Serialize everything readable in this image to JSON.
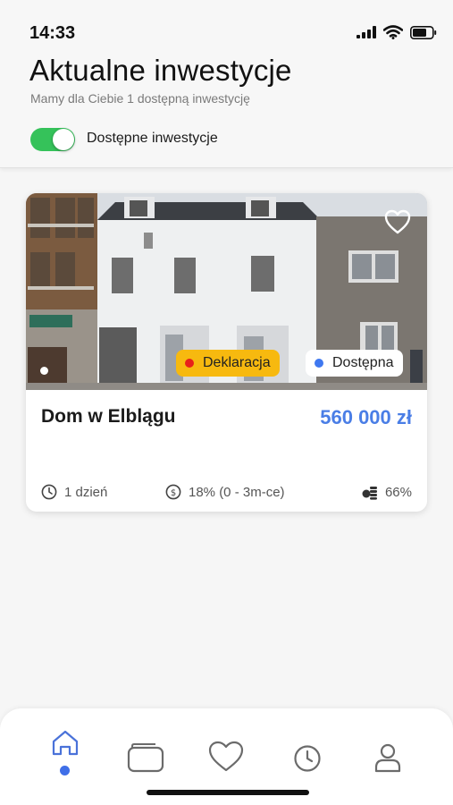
{
  "status_bar": {
    "time": "14:33"
  },
  "header": {
    "title": "Aktualne inwestycje",
    "subtitle": "Mamy dla Ciebie 1 dostępną inwestycję",
    "toggle_label": "Dostępne inwestycje",
    "toggle_on": true
  },
  "investment": {
    "title": "Dom w Elblągu",
    "price": "560 000 zł",
    "badges": [
      {
        "label": "Deklaracja",
        "dot_color": "#e8201a",
        "bg_color": "#f7b90f"
      },
      {
        "label": "Dostępna",
        "dot_color": "#3f78f0",
        "bg_color": "#ffffff"
      }
    ],
    "meta": [
      {
        "icon": "clock-icon",
        "text": "1 dzień"
      },
      {
        "icon": "dollar-icon",
        "text": "18% (0 - 3m-ce)"
      },
      {
        "icon": "coins-icon",
        "text": "66%"
      }
    ]
  },
  "bottom_nav": {
    "items": [
      {
        "icon": "home-icon",
        "active": true
      },
      {
        "icon": "wallet-icon",
        "active": false
      },
      {
        "icon": "heart-icon",
        "active": false
      },
      {
        "icon": "clock-icon",
        "active": false
      },
      {
        "icon": "user-icon",
        "active": false
      }
    ]
  },
  "colors": {
    "accent_blue": "#4a7ee6",
    "toggle_green": "#35c25a",
    "declaration_yellow": "#f7b90f"
  }
}
